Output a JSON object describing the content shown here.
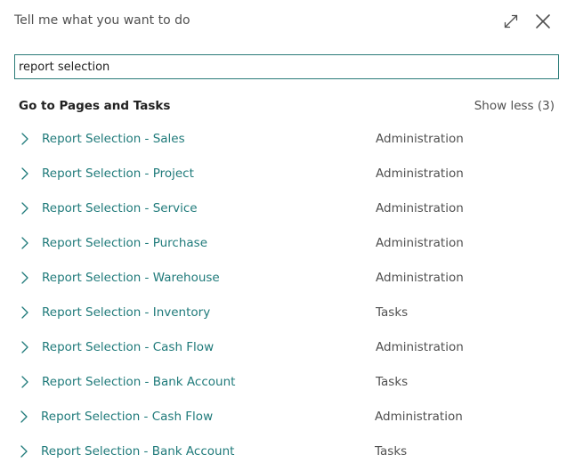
{
  "dialog": {
    "title": "Tell me what you want to do"
  },
  "search": {
    "value": "report selection",
    "placeholder": ""
  },
  "section": {
    "title": "Go to Pages and Tasks",
    "toggle_label": "Show less (3)"
  },
  "results": [
    {
      "label": "Report Selection - Sales",
      "category": "Administration"
    },
    {
      "label": "Report Selection - Project",
      "category": "Administration"
    },
    {
      "label": "Report Selection - Service",
      "category": "Administration"
    },
    {
      "label": "Report Selection - Purchase",
      "category": "Administration"
    },
    {
      "label": "Report Selection - Warehouse",
      "category": "Administration"
    },
    {
      "label": "Report Selection - Inventory",
      "category": "Tasks"
    },
    {
      "label": "Report Selection - Cash Flow",
      "category": "Administration"
    },
    {
      "label": "Report Selection - Bank Account",
      "category": "Tasks"
    },
    {
      "label": "Report Selection - Cash Flow",
      "category": "Administration"
    },
    {
      "label": "Report Selection - Bank Account",
      "category": "Tasks"
    }
  ],
  "icons": {
    "expand": "expand-diagonal-arrows-icon",
    "close": "close-icon",
    "chevron": "chevron-right-icon"
  },
  "colors": {
    "accent": "#1f7a7a",
    "search_border": "#2a7b78"
  }
}
